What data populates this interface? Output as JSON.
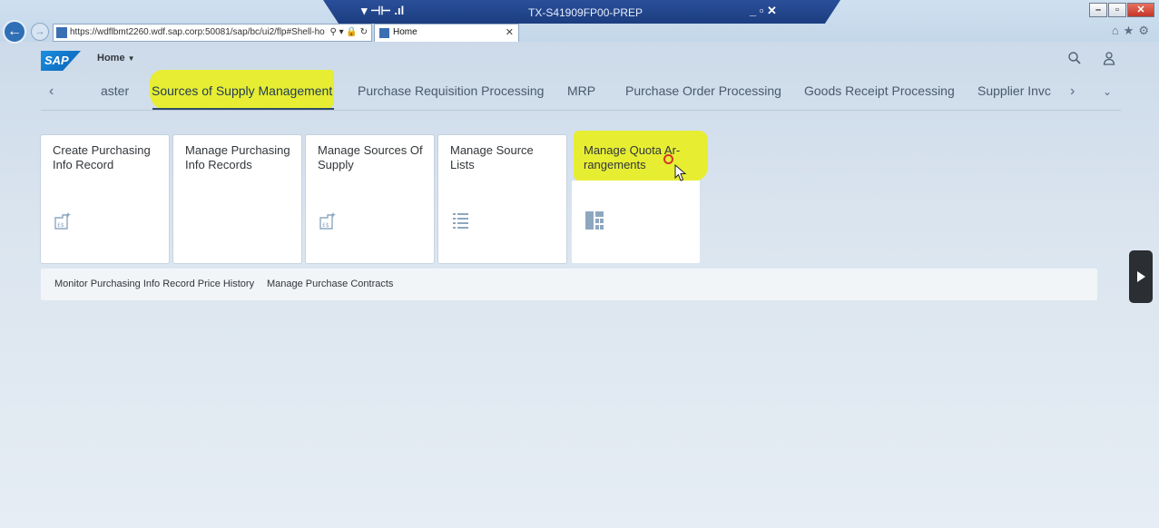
{
  "browser": {
    "rdp_title": "TX-S41909FP00-PREP",
    "address": "https://wdflbmt2260.wdf.sap.corp:50081/sap/bc/ui2/flp#Shell-ho",
    "tab_title": "Home"
  },
  "shell": {
    "logo_text": "SAP",
    "home_label": "Home"
  },
  "anchor_nav": {
    "items": [
      "aster",
      "Sources of Supply Management",
      "Purchase Requisition Processing",
      "MRP",
      "Purchase Order Processing",
      "Goods Receipt Processing",
      "Supplier Invc"
    ],
    "active_index": 1
  },
  "tiles": [
    {
      "title": "Create Purchasing Info Record",
      "icon": "purchasing-info-record-icon"
    },
    {
      "title": "Manage Purchasing Info Records",
      "icon": ""
    },
    {
      "title": "Manage Sources Of Supply",
      "icon": "purchasing-info-record-icon"
    },
    {
      "title": "Manage Source Lists",
      "icon": "list-icon"
    },
    {
      "title": "Manage Quota Ar-rangements",
      "icon": "quota-layout-icon"
    }
  ],
  "links": [
    "Monitor Purchasing Info Record Price History",
    "Manage Purchase Contracts"
  ],
  "colors": {
    "highlight": "#e9ef18",
    "sap_blue": "#0a6ed1",
    "tile_bg": "#ffffff",
    "icon": "#8ea7c0"
  }
}
